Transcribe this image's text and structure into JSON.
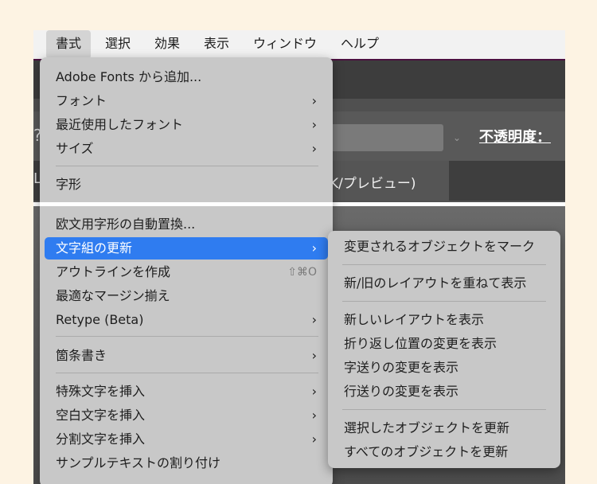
{
  "menubar": {
    "items": [
      {
        "label": "書式",
        "active": true
      },
      {
        "label": "選択"
      },
      {
        "label": "効果"
      },
      {
        "label": "表示"
      },
      {
        "label": "ウィンドウ"
      },
      {
        "label": "ヘルプ"
      }
    ]
  },
  "background": {
    "opacity_label": "不透明度：",
    "preview_tab": "K/プレビュー)",
    "left_glyph_1": "?",
    "left_glyph_2": "L",
    "dropdown_caret": "⌄"
  },
  "menu": {
    "items": [
      {
        "label": "Adobe Fonts から追加..."
      },
      {
        "label": "フォント",
        "submenu": true
      },
      {
        "label": "最近使用したフォント",
        "submenu": true
      },
      {
        "label": "サイズ",
        "submenu": true
      },
      {
        "label": "字形"
      },
      {
        "label": "欧文用字形の自動置換..."
      },
      {
        "label": "文字組の更新",
        "submenu": true,
        "highlighted": true
      },
      {
        "label": "アウトラインを作成",
        "shortcut": "⇧⌘O"
      },
      {
        "label": "最適なマージン揃え"
      },
      {
        "label": "Retype (Beta)",
        "submenu": true
      },
      {
        "label": "箇条書き",
        "submenu": true
      },
      {
        "label": "特殊文字を挿入",
        "submenu": true
      },
      {
        "label": "空白文字を挿入",
        "submenu": true
      },
      {
        "label": "分割文字を挿入",
        "submenu": true
      },
      {
        "label": "サンプルテキストの割り付け"
      }
    ],
    "chevron": "›"
  },
  "submenu": {
    "items": [
      {
        "label": "変更されるオブジェクトをマーク"
      },
      {
        "label": "新/旧のレイアウトを重ねて表示"
      },
      {
        "label": "新しいレイアウトを表示"
      },
      {
        "label": "折り返し位置の変更を表示"
      },
      {
        "label": "字送りの変更を表示"
      },
      {
        "label": "行送りの変更を表示"
      },
      {
        "label": "選択したオブジェクトを更新"
      },
      {
        "label": "すべてのオブジェクトを更新"
      }
    ]
  },
  "colors": {
    "highlight": "#2f7cf0",
    "menu_bg": "#c8c8c8",
    "frame_bg": "#fdf3e3",
    "menubar_accent": "#4c1140"
  }
}
